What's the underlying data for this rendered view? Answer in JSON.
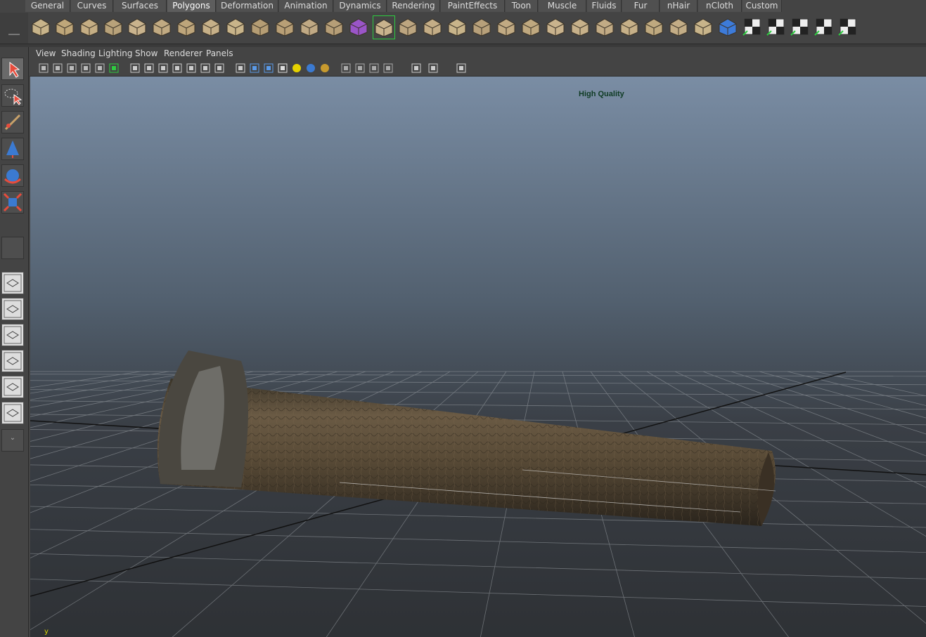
{
  "shelf_tabs": [
    "General",
    "Curves",
    "Surfaces",
    "Polygons",
    "Deformation",
    "Animation",
    "Dynamics",
    "Rendering",
    "PaintEffects",
    "Toon",
    "Muscle",
    "Fluids",
    "Fur",
    "nHair",
    "nCloth",
    "Custom"
  ],
  "active_tab": "Polygons",
  "shelf_icons": [
    "sphere-icon",
    "cube-icon",
    "cylinder-icon",
    "cone-icon",
    "plane-icon",
    "torus-icon",
    "pyramid-icon",
    "pipe-icon",
    "soccer-ball-icon",
    "separate-icon",
    "combine-icon",
    "smooth-icon",
    "reduce-icon",
    "poly-cube-icon",
    "mirror-icon",
    "extrude-face-icon",
    "merge-vertex-icon",
    "bevel-icon",
    "bridge-icon",
    "extrude-edge-icon",
    "wedge-icon",
    "split-polygon-icon",
    "insert-edge-loop-icon",
    "offset-loop-icon",
    "slide-edge-icon",
    "append-icon",
    "triangulate-icon",
    "quadrangulate-icon",
    "sculpt-icon",
    "uv-planar-icon",
    "uv-cylindrical-icon",
    "uv-spherical-icon",
    "uv-automatic-icon",
    "uv-checker-icon"
  ],
  "tools": [
    "select-tool-icon",
    "lasso-tool-icon",
    "paint-select-icon",
    "move-tool-icon",
    "rotate-tool-icon",
    "scale-tool-icon"
  ],
  "layouts": [
    "single-pane-layout-icon",
    "four-pane-layout-icon",
    "outliner-persp-layout-icon",
    "graph-persp-layout-icon",
    "hypershade-persp-layout-icon",
    "outliner-graph-layout-icon"
  ],
  "panel_menu": [
    "View",
    "Shading",
    "Lighting",
    "Show",
    "Renderer",
    "Panels"
  ],
  "panel_tools": [
    "camera-attr-icon",
    "bookmark-icon",
    "image-plane-icon",
    "2d-pan-icon",
    "grease-pencil-icon",
    "hud-icon",
    "grid-icon",
    "film-gate-icon",
    "resolution-gate-icon",
    "gate-mask-icon",
    "field-chart-icon",
    "safe-action-icon",
    "safe-title-icon",
    "wireframe-icon",
    "smooth-shade-icon",
    "wireframe-on-shaded-icon",
    "textured-icon",
    "use-all-lights-icon",
    "shadows-icon",
    "screen-ambient-icon",
    "depth-of-field-icon",
    "motion-blur-icon",
    "anti-alias-icon",
    "isolate-select-icon",
    "xray-icon",
    "xray-joints-icon",
    "backface-cull-icon"
  ],
  "viewport": {
    "hud_text": "High Quality",
    "axis_label": "y"
  },
  "colors": {
    "viewport_top": "#7a8da4",
    "viewport_bottom": "#2e3135",
    "accent_green": "#2ecc40",
    "hud_text": "#0f3b24"
  }
}
